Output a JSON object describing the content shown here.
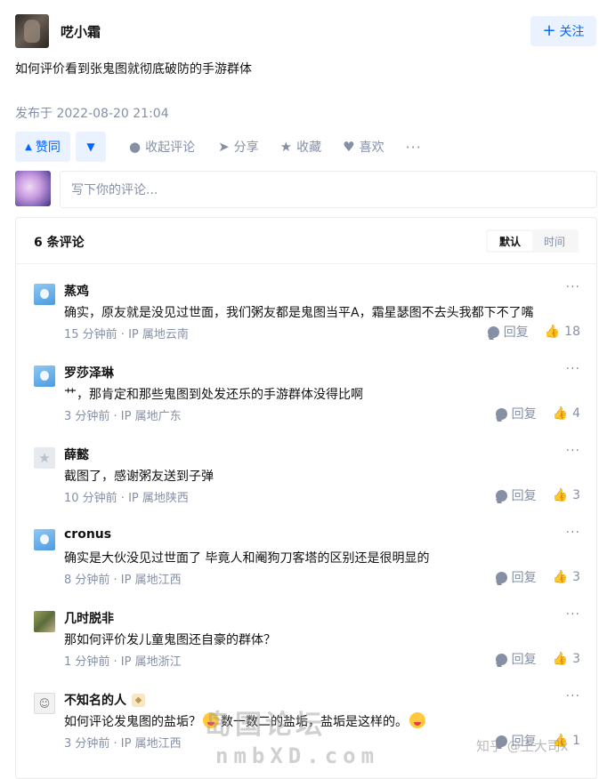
{
  "post": {
    "author": "呓小霜",
    "follow_label": "关注",
    "question": "如何评价看到张鬼图就彻底破防的手游群体",
    "publish_time": "发布于 2022-08-20 21:04"
  },
  "actions": {
    "upvote": "赞同",
    "collapse_comments": "收起评论",
    "share": "分享",
    "favorite": "收藏",
    "like": "喜欢",
    "more": "···"
  },
  "comment_input": {
    "placeholder": "写下你的评论..."
  },
  "comments": {
    "count_label": "6 条评论",
    "sort": {
      "default": "默认",
      "time": "时间",
      "active": "默认"
    },
    "reply_label": "回复",
    "items": [
      {
        "name": "蒸鸡",
        "text": "确实，原友就是没见过世面，我们粥友都是鬼图当平A，霜星瑟图不去头我都下不了嘴",
        "meta": "15 分钟前 · IP 属地云南",
        "likes": "18",
        "avatar": "blue"
      },
      {
        "name": "罗莎泽琳",
        "text": "艹，那肯定和那些鬼图到处发还乐的手游群体没得比啊",
        "meta": "3 分钟前 · IP 属地广东",
        "likes": "4",
        "avatar": "blue"
      },
      {
        "name": "薛懿",
        "text": "截图了，感谢粥友送到子弹",
        "meta": "10 分钟前 · IP 属地陕西",
        "likes": "3",
        "avatar": "gray"
      },
      {
        "name": "cronus",
        "text": "确实是大伙没见过世面了 毕竟人和阉狗刀客塔的区别还是很明显的",
        "meta": "8 分钟前 · IP 属地江西",
        "likes": "3",
        "avatar": "blue"
      },
      {
        "name": "几时脱非",
        "text": "那如何评价发儿童鬼图还自豪的群体？",
        "meta": "1 分钟前 · IP 属地浙江",
        "likes": "3",
        "avatar": "photo"
      },
      {
        "name": "不知名的人",
        "text_a": "如何评论发鬼图的盐垢？",
        "text_b": "数一数二的盐垢，盐垢是这样的。",
        "meta": "3 分钟前 · IP 属地江西",
        "likes": "1",
        "avatar": "sketch"
      }
    ]
  },
  "watermarks": {
    "main": "岛国论坛",
    "sub": "nmbXD.com",
    "zhihu": "知乎 @王大司x"
  },
  "colors": {
    "accent": "#0066ff",
    "accent_bg": "#eaf2ff",
    "muted": "#8590a6"
  }
}
